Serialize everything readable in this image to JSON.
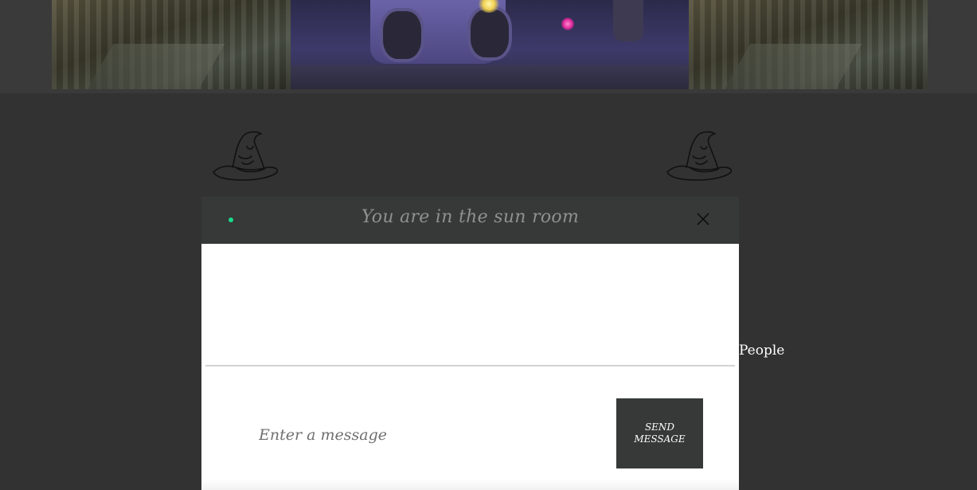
{
  "chat": {
    "title": "You are in the sun room",
    "status": "online",
    "input_placeholder": "Enter a message",
    "input_value": "",
    "send_label": "SEND MESSAGE"
  },
  "sidebar": {
    "people_label": "People"
  },
  "icons": {
    "left_hat": "sorting-hat-icon",
    "right_hat": "sorting-hat-icon",
    "close": "close-icon"
  },
  "colors": {
    "page_background": "#323232",
    "header_background": "#363938",
    "status_dot": "#19d98a",
    "send_button": "#363938",
    "title_text": "#8e918f"
  }
}
